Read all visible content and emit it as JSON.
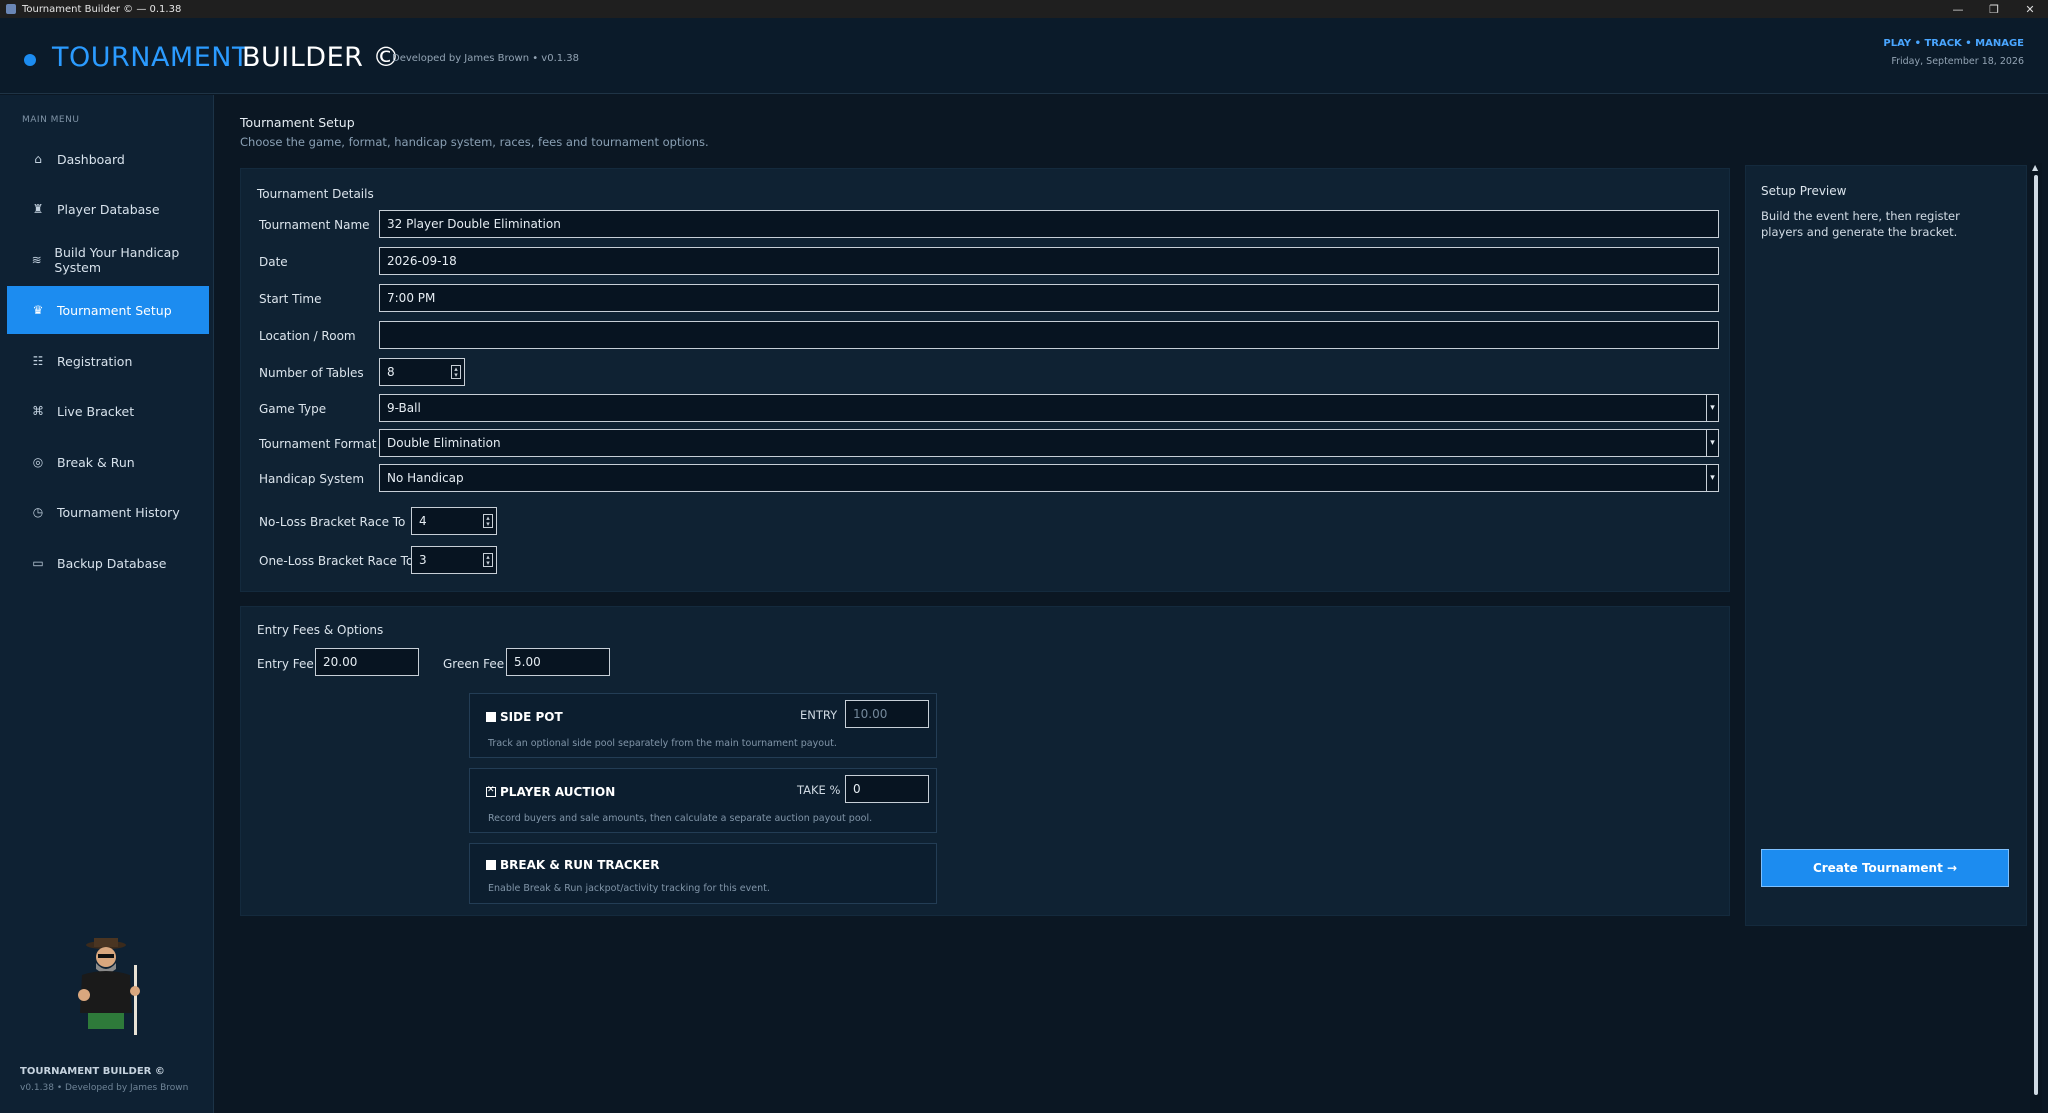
{
  "window": {
    "title": "Tournament Builder © — 0.1.38",
    "controls": [
      "—",
      "❐",
      "✕"
    ]
  },
  "header": {
    "brand_primary": "TOURNAMENT",
    "brand_secondary": "BUILDER ©",
    "developer": "Developed by James Brown  •  v0.1.38",
    "nav": "PLAY  •  TRACK  •  MANAGE",
    "date": "Friday, September 18, 2026"
  },
  "sidebar": {
    "menu_label": "MAIN MENU",
    "items": [
      {
        "label": "Dashboard",
        "icon": "home-icon",
        "glyph": "⌂"
      },
      {
        "label": "Player Database",
        "icon": "player-icon",
        "glyph": "♜"
      },
      {
        "label": "Build Your Handicap System",
        "icon": "handicap-icon",
        "glyph": "≋"
      },
      {
        "label": "Tournament Setup",
        "icon": "trophy-icon",
        "glyph": "♛"
      },
      {
        "label": "Registration",
        "icon": "list-icon",
        "glyph": "☷"
      },
      {
        "label": "Live Bracket",
        "icon": "bracket-icon",
        "glyph": "⌘"
      },
      {
        "label": "Break & Run",
        "icon": "target-icon",
        "glyph": "◎"
      },
      {
        "label": "Tournament History",
        "icon": "history-icon",
        "glyph": "◷"
      },
      {
        "label": "Backup Database",
        "icon": "database-icon",
        "glyph": "▭"
      }
    ],
    "active_index": 3,
    "footer_title": "TOURNAMENT BUILDER ©",
    "footer_sub": "v0.1.38  •  Developed by James Brown"
  },
  "page": {
    "title": "Tournament Setup",
    "subtitle": "Choose the game, format, handicap system, races, fees and tournament options."
  },
  "details": {
    "title": "Tournament Details",
    "name_label": "Tournament Name",
    "name_value": "32 Player Double Elimination",
    "date_label": "Date",
    "date_value": "2026-09-18",
    "time_label": "Start Time",
    "time_value": "7:00 PM",
    "location_label": "Location / Room",
    "location_value": "",
    "tables_label": "Number of Tables",
    "tables_value": "8",
    "game_label": "Game Type",
    "game_value": "9-Ball",
    "format_label": "Tournament Format",
    "format_value": "Double Elimination",
    "handicap_label": "Handicap System",
    "handicap_value": "No Handicap",
    "noloss_label": "No-Loss Bracket Race To",
    "noloss_value": "4",
    "oneloss_label": "One-Loss Bracket Race To",
    "oneloss_value": "3"
  },
  "fees": {
    "title": "Entry Fees & Options",
    "entry_label": "Entry Fee",
    "entry_value": "20.00",
    "green_label": "Green Fee",
    "green_value": "5.00",
    "side_pot": {
      "title": "SIDE POT",
      "checked": true,
      "field_label": "ENTRY",
      "field_value": "10.00",
      "description": "Track an optional side pool separately from the main tournament payout."
    },
    "auction": {
      "title": "PLAYER AUCTION",
      "checked": false,
      "field_label": "TAKE %",
      "field_value": "0",
      "description": "Record buyers and sale amounts, then calculate a separate auction payout pool."
    },
    "break_run": {
      "title": "BREAK & RUN TRACKER",
      "checked": true,
      "description": "Enable Break & Run jackpot/activity tracking for this event."
    }
  },
  "preview": {
    "title": "Setup Preview",
    "text": "Build the event here, then register players and generate the bracket.",
    "button": "Create Tournament →"
  },
  "colors": {
    "accent": "#1c8cf0",
    "background": "#0b1723",
    "card": "#0f2233"
  }
}
